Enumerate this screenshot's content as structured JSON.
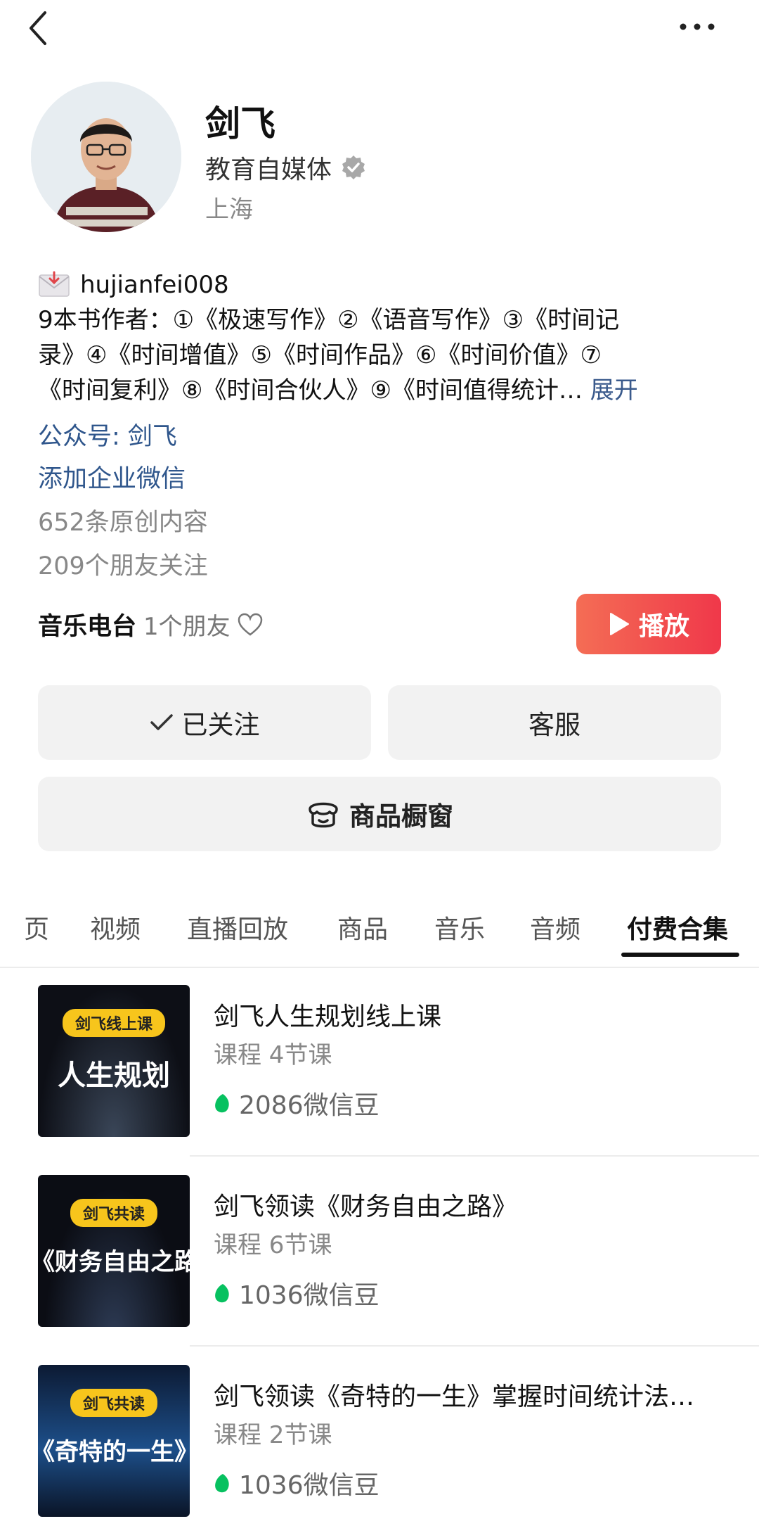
{
  "profile": {
    "name": "剑飞",
    "role": "教育自媒体",
    "location": "上海",
    "handle": "hujianfei008",
    "bio_lines": [
      "9本书作者：①《极速写作》②《语音写作》③《时间记",
      "录》④《时间增值》⑤《时间作品》⑥《时间价值》⑦",
      "《时间复利》⑧《时间合伙人》⑨《时间值得统计… "
    ],
    "expand_label": "展开",
    "official_account": "公众号: 剑飞",
    "add_wecom": "添加企业微信",
    "original_count": "652条原创内容",
    "friends_following": "209个朋友关注"
  },
  "radio": {
    "title": "音乐电台",
    "friends": "1个朋友",
    "play_label": "播放"
  },
  "actions": {
    "follow_label": "已关注",
    "service_label": "客服",
    "shop_label": "商品橱窗"
  },
  "tabs": [
    {
      "label": "页"
    },
    {
      "label": "视频"
    },
    {
      "label": "直播回放"
    },
    {
      "label": "商品"
    },
    {
      "label": "音乐"
    },
    {
      "label": "音频"
    },
    {
      "label": "付费合集"
    }
  ],
  "active_tab": "付费合集",
  "courses": [
    {
      "badge": "剑飞线上课",
      "thumb_title": "人生规划",
      "title": "剑飞人生规划线上课",
      "meta": "课程 4节课",
      "price": "2086微信豆"
    },
    {
      "badge": "剑飞共读",
      "thumb_title": "《财务自由之路》",
      "title": "剑飞领读《财务自由之路》",
      "meta": "课程 6节课",
      "price": "1036微信豆"
    },
    {
      "badge": "剑飞共读",
      "thumb_title": "《奇特的一生》",
      "title": "剑飞领读《奇特的一生》掌握时间统计法…",
      "meta": "课程 2节课",
      "price": "1036微信豆"
    }
  ],
  "colors": {
    "link": "#2f568c",
    "play_gradient_start": "#f46d55",
    "play_gradient_end": "#f0384a",
    "button_bg": "#f2f2f2",
    "bean_green": "#07c160",
    "badge_yellow": "#f7c51c"
  }
}
